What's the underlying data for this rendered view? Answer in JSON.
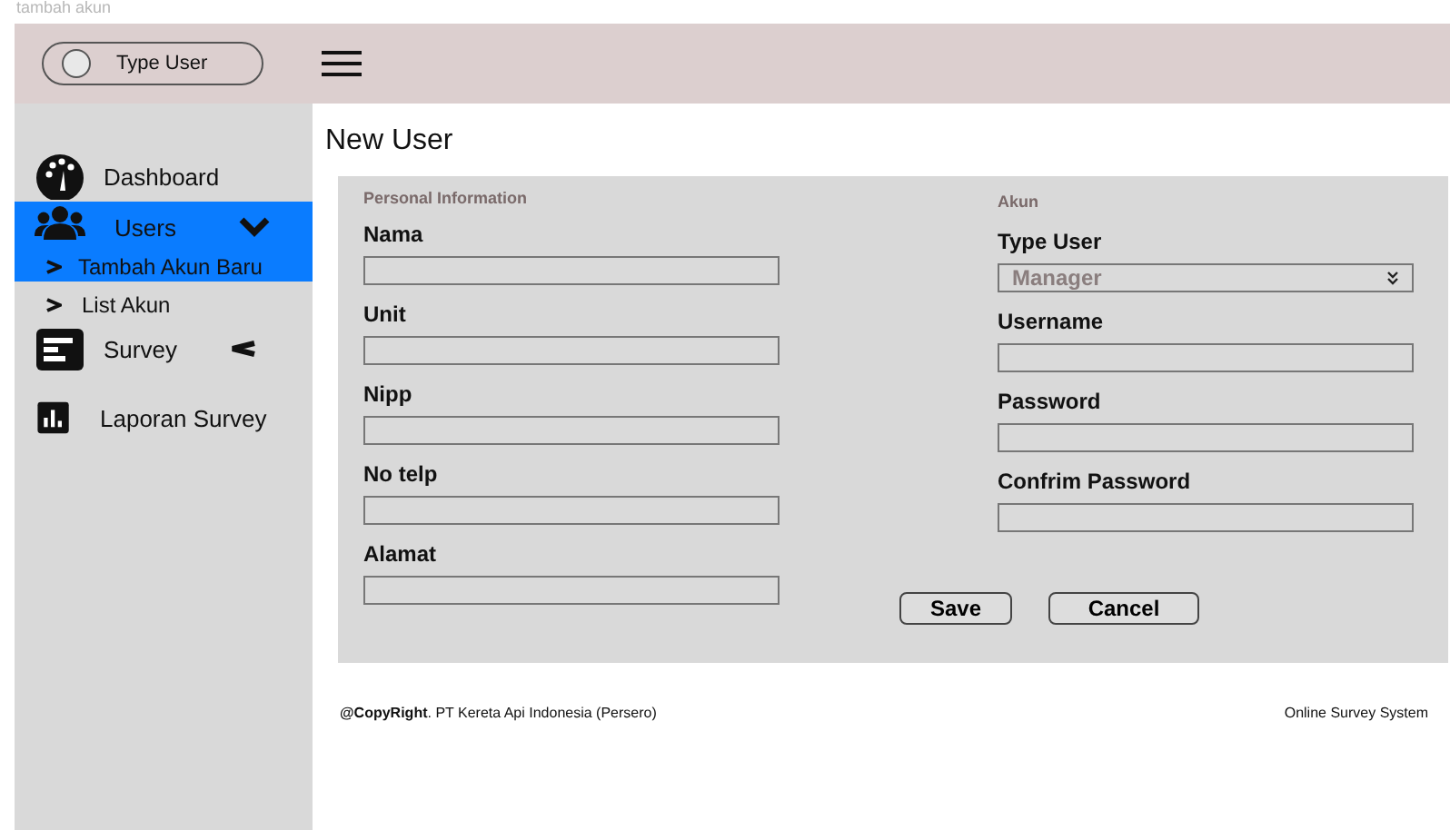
{
  "top_label": "tambah akun",
  "header": {
    "toggle": {
      "label": "Type User",
      "on": false
    }
  },
  "sidebar": {
    "items": [
      {
        "label": "Dashboard",
        "selected": false
      },
      {
        "label": "Users",
        "selected": true,
        "expanded": true,
        "children": [
          {
            "label": "Tambah Akun Baru",
            "selected": true
          },
          {
            "label": "List Akun",
            "selected": false
          }
        ]
      },
      {
        "label": "Survey",
        "selected": false,
        "expanded": false
      },
      {
        "label": "Laporan Survey",
        "selected": false
      }
    ]
  },
  "page_title": "New User",
  "form": {
    "sections": [
      {
        "title": "Personal Information",
        "fields": [
          {
            "kind": "text",
            "label": "Nama"
          },
          {
            "kind": "text",
            "label": "Unit"
          },
          {
            "kind": "text",
            "label": "Nipp"
          },
          {
            "kind": "text",
            "label": "No telp"
          },
          {
            "kind": "text",
            "label": "Alamat"
          }
        ]
      },
      {
        "title": "Akun",
        "fields": [
          {
            "kind": "select",
            "label": "Type User",
            "value": "Manager"
          },
          {
            "kind": "text",
            "label": "Username"
          },
          {
            "kind": "text",
            "label": "Password"
          },
          {
            "kind": "text",
            "label": "Confrim Password"
          }
        ]
      }
    ],
    "buttons": [
      "Save",
      "Cancel"
    ]
  },
  "footer": {
    "copyright": "**@CopyRight**. PT Kereta Api Indonesia (Persero)",
    "app_name": "Online Survey System"
  }
}
